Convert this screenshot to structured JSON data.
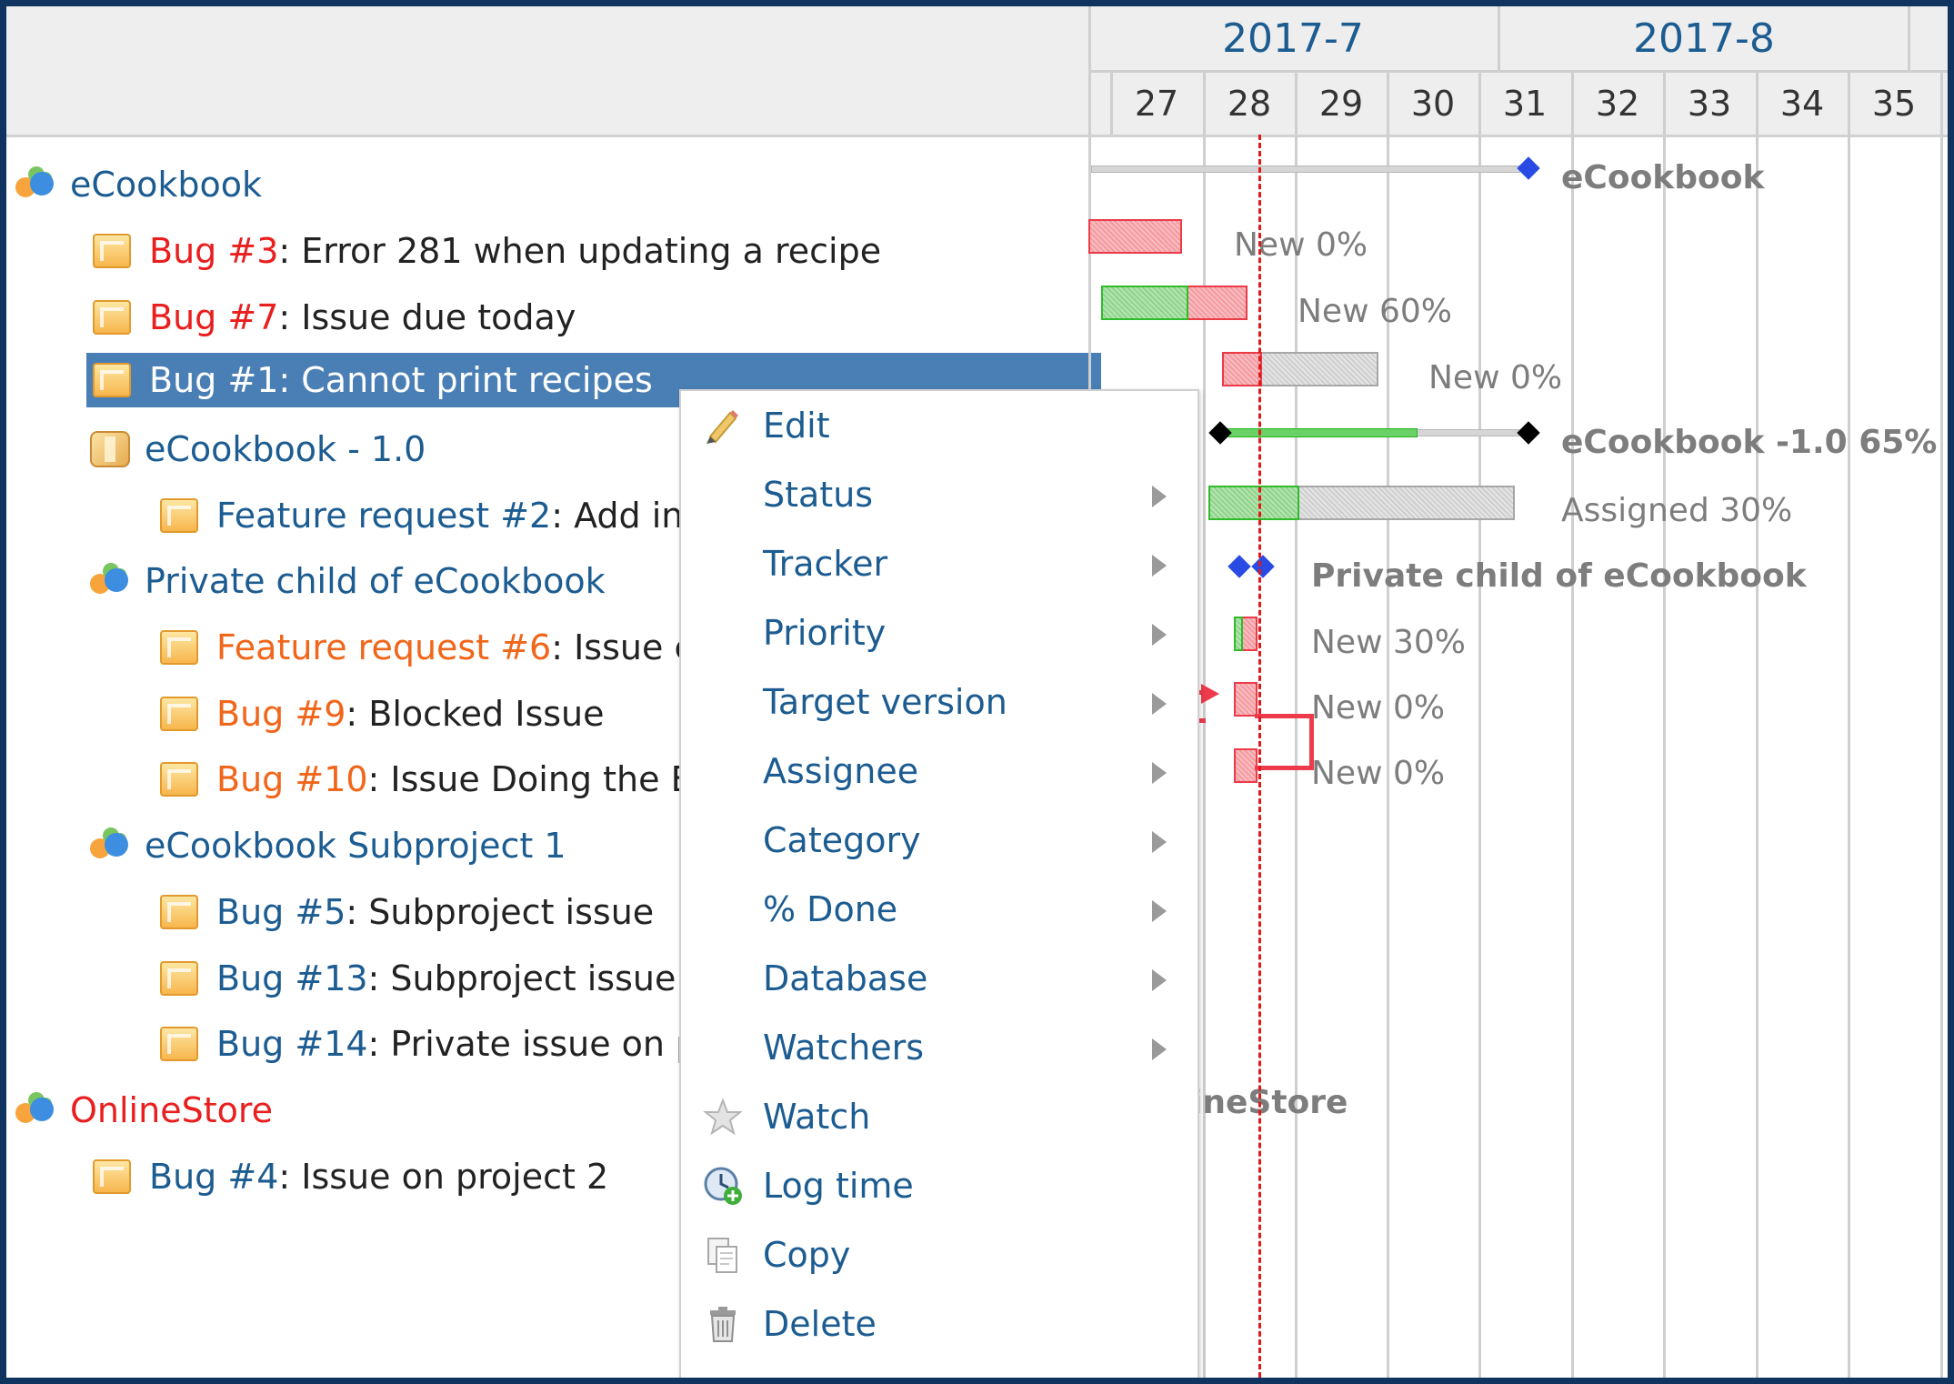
{
  "gantt": {
    "months": [
      "2017-7",
      "2017-8"
    ],
    "weeks": [
      "27",
      "28",
      "29",
      "30",
      "31",
      "32",
      "33",
      "34",
      "35"
    ],
    "today_week_position": 28.6
  },
  "subjects": [
    {
      "type": "project",
      "link": "eCookbook",
      "text": "",
      "style": "lnk",
      "selected": false
    },
    {
      "type": "issue",
      "link": "Bug #3",
      "text": ": Error 281 when updating a recipe",
      "style": "red",
      "selected": false
    },
    {
      "type": "issue",
      "link": "Bug #7",
      "text": ": Issue due today",
      "style": "red",
      "selected": false
    },
    {
      "type": "issue",
      "link": "Bug #1",
      "text": ": Cannot print recipes",
      "style": "red",
      "selected": true
    },
    {
      "type": "version",
      "link": "eCookbook - 1.0",
      "text": "",
      "style": "lnk",
      "selected": false
    },
    {
      "type": "issue",
      "link": "Feature request #2",
      "text": ": Add ing",
      "style": "lnk",
      "selected": false
    },
    {
      "type": "project",
      "link": "Private child of eCookbook",
      "text": "",
      "style": "lnk",
      "selected": false
    },
    {
      "type": "issue",
      "link": "Feature request #6",
      "text": ": Issue c",
      "style": "orange",
      "selected": false
    },
    {
      "type": "issue",
      "link": "Bug #9",
      "text": ": Blocked Issue",
      "style": "orange",
      "selected": false
    },
    {
      "type": "issue",
      "link": "Bug #10",
      "text": ": Issue Doing the E",
      "style": "orange",
      "selected": false
    },
    {
      "type": "project",
      "link": "eCookbook Subproject 1",
      "text": "",
      "style": "lnk",
      "selected": false
    },
    {
      "type": "issue",
      "link": "Bug #5",
      "text": ": Subproject issue",
      "style": "lnk",
      "selected": false
    },
    {
      "type": "issue",
      "link": "Bug #13",
      "text": ": Subproject issue",
      "style": "lnk",
      "selected": false
    },
    {
      "type": "issue",
      "link": "Bug #14",
      "text": ": Private issue on p",
      "style": "lnk",
      "selected": false
    },
    {
      "type": "project",
      "link": "OnlineStore",
      "text": "",
      "style": "red",
      "selected": false
    },
    {
      "type": "issue",
      "link": "Bug #4",
      "text": ": Issue on project 2",
      "style": "lnk",
      "selected": false
    }
  ],
  "bar_labels": {
    "ecookbook": "eCookbook",
    "bug3": "New 0%",
    "bug7": "New 60%",
    "bug1": "New 0%",
    "version": "eCookbook -1.0 65%",
    "feature2": "Assigned 30%",
    "private_child": "Private child of eCookbook",
    "feature6": "New 30%",
    "bug9": "New 0%",
    "bug10": "New 0%",
    "onlinestore": "ineStore"
  },
  "progress": {
    "bug7_done_fraction": 0.6,
    "version_done_fraction": 0.65,
    "feature2_done_fraction": 0.3,
    "feature6_done_fraction": 0.3
  },
  "context_menu": {
    "items": [
      {
        "label": "Edit",
        "icon": "pencil-icon",
        "submenu": false
      },
      {
        "label": "Status",
        "icon": "",
        "submenu": true
      },
      {
        "label": "Tracker",
        "icon": "",
        "submenu": true
      },
      {
        "label": "Priority",
        "icon": "",
        "submenu": true
      },
      {
        "label": "Target version",
        "icon": "",
        "submenu": true
      },
      {
        "label": "Assignee",
        "icon": "",
        "submenu": true
      },
      {
        "label": "Category",
        "icon": "",
        "submenu": true
      },
      {
        "label": "% Done",
        "icon": "",
        "submenu": true
      },
      {
        "label": "Database",
        "icon": "",
        "submenu": true
      },
      {
        "label": "Watchers",
        "icon": "",
        "submenu": true
      },
      {
        "label": "Watch",
        "icon": "star-icon",
        "submenu": false
      },
      {
        "label": "Log time",
        "icon": "clock-add-icon",
        "submenu": false
      },
      {
        "label": "Copy",
        "icon": "copy-icon",
        "submenu": false
      },
      {
        "label": "Delete",
        "icon": "trash-icon",
        "submenu": false
      }
    ]
  },
  "colors": {
    "link": "#1c5c91",
    "bug_red": "#e91e1e",
    "bug_orange": "#f0661a",
    "selected_row": "#4a7fb5",
    "today_line": "#e01818",
    "frame": "#0f3460"
  }
}
